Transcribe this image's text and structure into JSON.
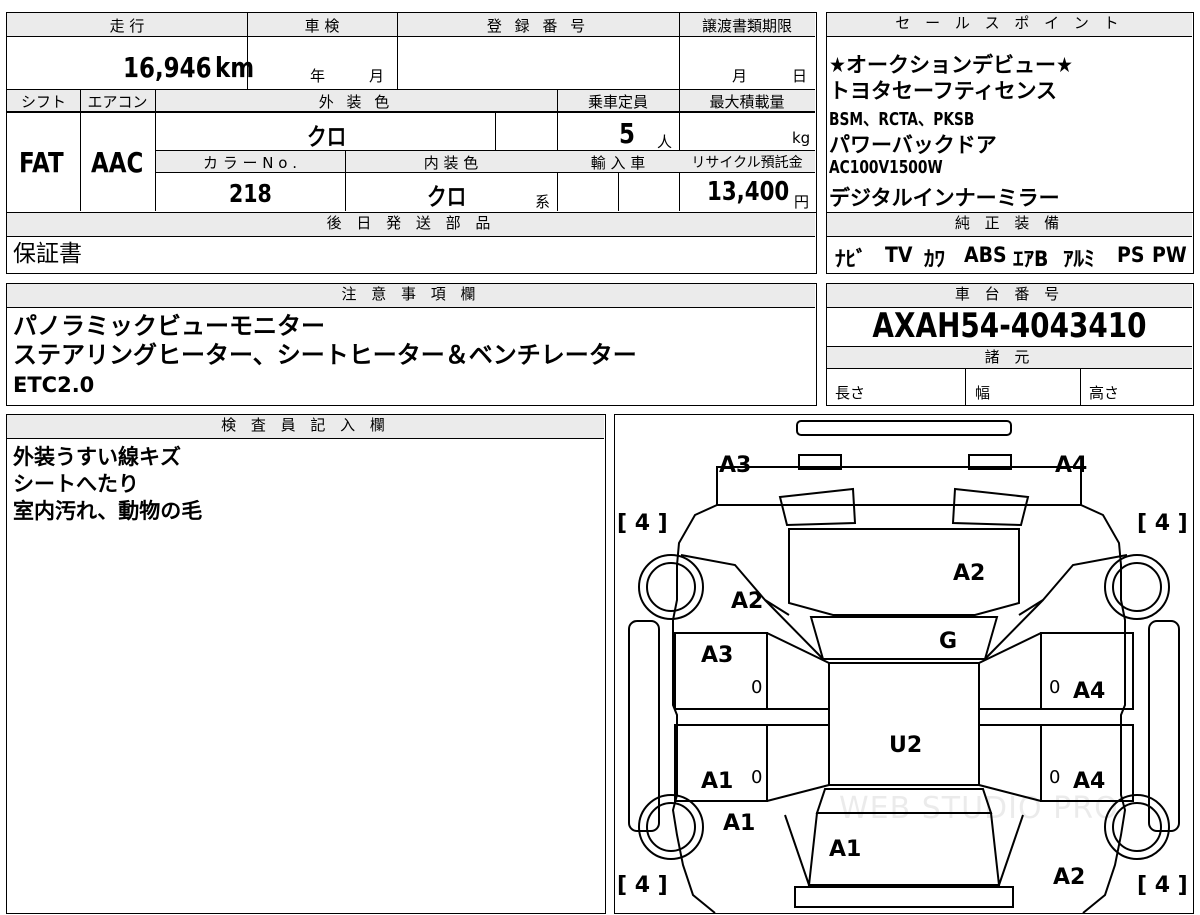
{
  "spec": {
    "mileage_label": "走 行",
    "mileage_value": "16,946",
    "mileage_unit": "km",
    "inspection_label": "車 検",
    "inspection_year": "年",
    "inspection_month": "月",
    "registration_label": "登 録 番 号",
    "transfer_label": "譲渡書類期限",
    "transfer_month": "月",
    "transfer_day": "日",
    "shift_label": "シフト",
    "shift_value": "FAT",
    "ac_label": "エアコン",
    "ac_value": "AAC",
    "exterior_label": "外 装 色",
    "exterior_value": "クロ",
    "capacity_label": "乗車定員",
    "capacity_value": "5",
    "capacity_unit": "人",
    "maxload_label": "最大積載量",
    "maxload_unit": "kg",
    "colorno_label": "カ ラ ー N o .",
    "colorno_value": "218",
    "interior_label": "内 装 色",
    "interior_value": "クロ",
    "interior_suffix": "系",
    "import_label": "輸 入 車",
    "recycle_label": "リサイクル預託金",
    "recycle_value": "13,400",
    "recycle_unit": "円"
  },
  "later_parts": {
    "label": "後 日 発 送 部 品",
    "value": "保証書"
  },
  "sales_points": {
    "label": "セ ー ル ス ポ イ ン ト",
    "items": [
      "★オークションデビュー★",
      "トヨタセーフティセンス",
      "BSM、RCTA、PKSB",
      "パワーバックドア",
      "AC100V1500W",
      "デジタルインナーミラー"
    ]
  },
  "equipment": {
    "label": "純 正 装 備",
    "items": [
      "ﾅﾋﾞ",
      "TV",
      "ｶﾜ",
      "ABS",
      "ｴｱB",
      "ｱﾙﾐ",
      "PS",
      "PW"
    ]
  },
  "notes": {
    "label": "注 意 事 項 欄",
    "lines": [
      "パノラミックビューモニター",
      "ステアリングヒーター、シートヒーター＆ベンチレーター",
      "ETC2.0"
    ]
  },
  "chassis": {
    "label": "車 台 番 号",
    "value": "AXAH54-4043410"
  },
  "dimensions": {
    "label": "諸 元",
    "length": "長さ",
    "width": "幅",
    "height": "高さ"
  },
  "inspector": {
    "label": "検 査 員 記 入 欄",
    "lines": [
      "外装うすい線キズ",
      "シートへたり",
      "室内汚れ、動物の毛"
    ]
  },
  "diagram": {
    "tire_fl": "[ 4 ]",
    "tire_fr": "[ 4 ]",
    "tire_rl": "[ 4 ]",
    "tire_rr": "[ 4 ]",
    "front_left_corner": "A3",
    "front_right_corner": "A4",
    "hood": "A2",
    "left_fender": "A2",
    "windshield": "G",
    "left_front_door": "A3",
    "right_front_door": "A4",
    "roof": "U2",
    "left_rear_door": "A1",
    "right_rear_door": "A4",
    "left_rear_fender": "A1",
    "trunk": "A1",
    "right_rear_corner": "A2",
    "zero_lf": "0",
    "zero_rf": "0",
    "zero_lr": "0",
    "zero_rr": "0",
    "watermark": "WEB STUDIO PRO"
  }
}
